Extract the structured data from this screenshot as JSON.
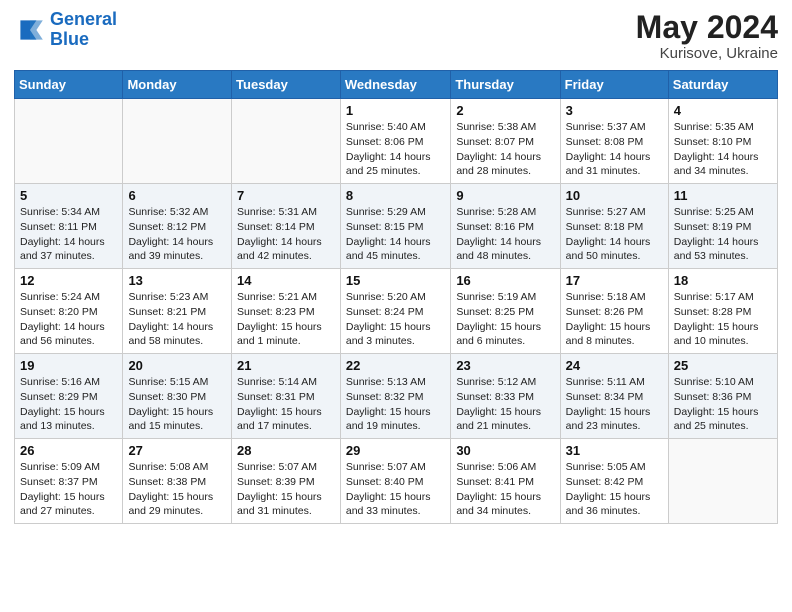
{
  "header": {
    "logo_line1": "General",
    "logo_line2": "Blue",
    "month_year": "May 2024",
    "location": "Kurisove, Ukraine"
  },
  "weekdays": [
    "Sunday",
    "Monday",
    "Tuesday",
    "Wednesday",
    "Thursday",
    "Friday",
    "Saturday"
  ],
  "weeks": [
    [
      {
        "day": "",
        "info": ""
      },
      {
        "day": "",
        "info": ""
      },
      {
        "day": "",
        "info": ""
      },
      {
        "day": "1",
        "info": "Sunrise: 5:40 AM\nSunset: 8:06 PM\nDaylight: 14 hours\nand 25 minutes."
      },
      {
        "day": "2",
        "info": "Sunrise: 5:38 AM\nSunset: 8:07 PM\nDaylight: 14 hours\nand 28 minutes."
      },
      {
        "day": "3",
        "info": "Sunrise: 5:37 AM\nSunset: 8:08 PM\nDaylight: 14 hours\nand 31 minutes."
      },
      {
        "day": "4",
        "info": "Sunrise: 5:35 AM\nSunset: 8:10 PM\nDaylight: 14 hours\nand 34 minutes."
      }
    ],
    [
      {
        "day": "5",
        "info": "Sunrise: 5:34 AM\nSunset: 8:11 PM\nDaylight: 14 hours\nand 37 minutes."
      },
      {
        "day": "6",
        "info": "Sunrise: 5:32 AM\nSunset: 8:12 PM\nDaylight: 14 hours\nand 39 minutes."
      },
      {
        "day": "7",
        "info": "Sunrise: 5:31 AM\nSunset: 8:14 PM\nDaylight: 14 hours\nand 42 minutes."
      },
      {
        "day": "8",
        "info": "Sunrise: 5:29 AM\nSunset: 8:15 PM\nDaylight: 14 hours\nand 45 minutes."
      },
      {
        "day": "9",
        "info": "Sunrise: 5:28 AM\nSunset: 8:16 PM\nDaylight: 14 hours\nand 48 minutes."
      },
      {
        "day": "10",
        "info": "Sunrise: 5:27 AM\nSunset: 8:18 PM\nDaylight: 14 hours\nand 50 minutes."
      },
      {
        "day": "11",
        "info": "Sunrise: 5:25 AM\nSunset: 8:19 PM\nDaylight: 14 hours\nand 53 minutes."
      }
    ],
    [
      {
        "day": "12",
        "info": "Sunrise: 5:24 AM\nSunset: 8:20 PM\nDaylight: 14 hours\nand 56 minutes."
      },
      {
        "day": "13",
        "info": "Sunrise: 5:23 AM\nSunset: 8:21 PM\nDaylight: 14 hours\nand 58 minutes."
      },
      {
        "day": "14",
        "info": "Sunrise: 5:21 AM\nSunset: 8:23 PM\nDaylight: 15 hours\nand 1 minute."
      },
      {
        "day": "15",
        "info": "Sunrise: 5:20 AM\nSunset: 8:24 PM\nDaylight: 15 hours\nand 3 minutes."
      },
      {
        "day": "16",
        "info": "Sunrise: 5:19 AM\nSunset: 8:25 PM\nDaylight: 15 hours\nand 6 minutes."
      },
      {
        "day": "17",
        "info": "Sunrise: 5:18 AM\nSunset: 8:26 PM\nDaylight: 15 hours\nand 8 minutes."
      },
      {
        "day": "18",
        "info": "Sunrise: 5:17 AM\nSunset: 8:28 PM\nDaylight: 15 hours\nand 10 minutes."
      }
    ],
    [
      {
        "day": "19",
        "info": "Sunrise: 5:16 AM\nSunset: 8:29 PM\nDaylight: 15 hours\nand 13 minutes."
      },
      {
        "day": "20",
        "info": "Sunrise: 5:15 AM\nSunset: 8:30 PM\nDaylight: 15 hours\nand 15 minutes."
      },
      {
        "day": "21",
        "info": "Sunrise: 5:14 AM\nSunset: 8:31 PM\nDaylight: 15 hours\nand 17 minutes."
      },
      {
        "day": "22",
        "info": "Sunrise: 5:13 AM\nSunset: 8:32 PM\nDaylight: 15 hours\nand 19 minutes."
      },
      {
        "day": "23",
        "info": "Sunrise: 5:12 AM\nSunset: 8:33 PM\nDaylight: 15 hours\nand 21 minutes."
      },
      {
        "day": "24",
        "info": "Sunrise: 5:11 AM\nSunset: 8:34 PM\nDaylight: 15 hours\nand 23 minutes."
      },
      {
        "day": "25",
        "info": "Sunrise: 5:10 AM\nSunset: 8:36 PM\nDaylight: 15 hours\nand 25 minutes."
      }
    ],
    [
      {
        "day": "26",
        "info": "Sunrise: 5:09 AM\nSunset: 8:37 PM\nDaylight: 15 hours\nand 27 minutes."
      },
      {
        "day": "27",
        "info": "Sunrise: 5:08 AM\nSunset: 8:38 PM\nDaylight: 15 hours\nand 29 minutes."
      },
      {
        "day": "28",
        "info": "Sunrise: 5:07 AM\nSunset: 8:39 PM\nDaylight: 15 hours\nand 31 minutes."
      },
      {
        "day": "29",
        "info": "Sunrise: 5:07 AM\nSunset: 8:40 PM\nDaylight: 15 hours\nand 33 minutes."
      },
      {
        "day": "30",
        "info": "Sunrise: 5:06 AM\nSunset: 8:41 PM\nDaylight: 15 hours\nand 34 minutes."
      },
      {
        "day": "31",
        "info": "Sunrise: 5:05 AM\nSunset: 8:42 PM\nDaylight: 15 hours\nand 36 minutes."
      },
      {
        "day": "",
        "info": ""
      }
    ]
  ]
}
